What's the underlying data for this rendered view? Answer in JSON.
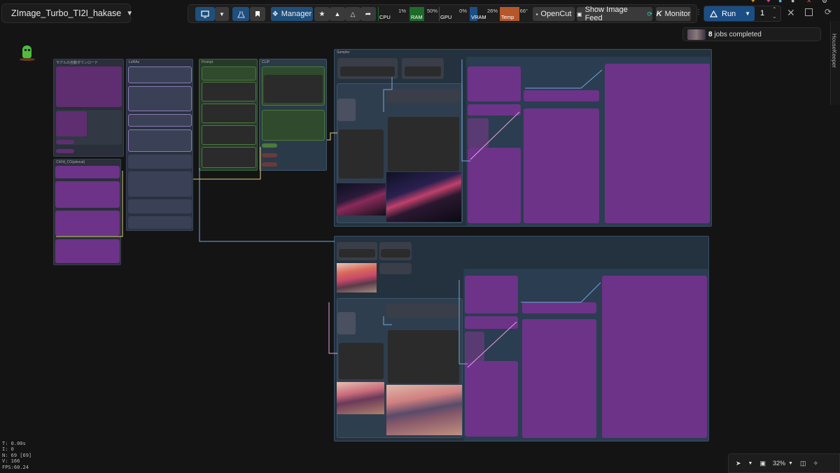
{
  "workflow": {
    "title": "ZImage_Turbo_TI2I_hakase"
  },
  "toolbar": {
    "manager_label": "Manager",
    "monitors": [
      {
        "label": "CPU",
        "value": "1%",
        "fill": 0.01,
        "color": "#1c6b2a"
      },
      {
        "label": "RAM",
        "value": "50%",
        "fill": 0.5,
        "color": "#1c6b2a"
      },
      {
        "label": "GPU",
        "value": "0%",
        "fill": 0.0,
        "color": "#1c6b2a"
      },
      {
        "label": "VRAM",
        "value": "26%",
        "fill": 0.26,
        "color": "#1c4e86"
      },
      {
        "label": "Temp",
        "value": "66°",
        "fill": 0.66,
        "color": "#b4572a"
      }
    ],
    "opencut_label": "OpenCut",
    "image_feed_label": "Show Image Feed",
    "monitor_label": "Monitor",
    "run_label": "Run",
    "queue_count": "1"
  },
  "jobs": {
    "count": "8",
    "label": "jobs completed"
  },
  "sidebar": {
    "housekeeper_label": "HouseKeeper"
  },
  "canvas": {
    "group_labels": {
      "model_download": "モデルの自動ダウンロード",
      "loras": "LoRAs",
      "prompt": "Prompt",
      "clip": "CLIP",
      "sampler": "Sampler",
      "chfill": "ChFill_CO(ptional)"
    }
  },
  "stats": {
    "t": "T: 0.00s",
    "i": "I: 0",
    "n": "N: 69 [69]",
    "v": "V: 166",
    "fps": "FPS:60.24"
  },
  "zoom": {
    "level": "32%"
  },
  "colors": {
    "accent": "#1c4e86",
    "node_purple": "#6d3388",
    "group_slate": "#2a3a4a",
    "link_blue": "#6fa8dc",
    "link_pink": "#e6a0e6",
    "link_yellow": "#e0d080"
  }
}
